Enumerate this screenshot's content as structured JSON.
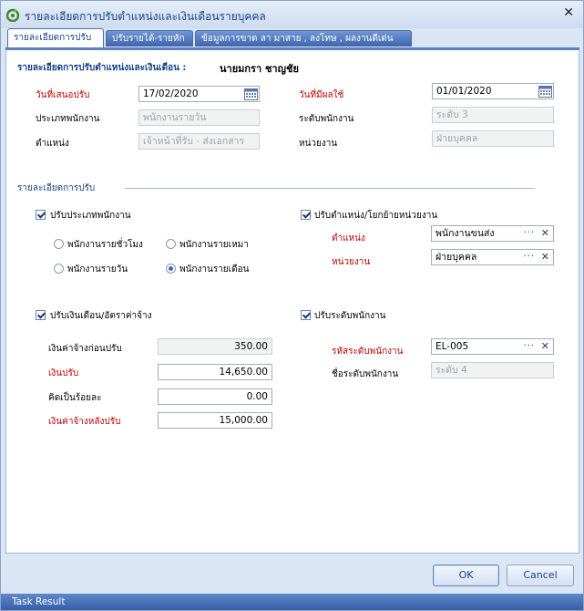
{
  "window": {
    "title": "รายละเอียดการปรับตำแหน่งและเงินเดือนรายบุคคล",
    "close_glyph": "✕"
  },
  "tabs": [
    {
      "label": "รายละเอียดการปรับ",
      "active": true
    },
    {
      "label": "ปรับรายได้-รายหัก",
      "active": false
    },
    {
      "label": "ข้อมูลการขาด ลา มาสาย , ลงโทษ , ผลงานดีเด่น",
      "active": false
    }
  ],
  "header": {
    "section_title": "รายละเอียดการปรับตำแหน่งและเงินเดือน :",
    "employee_name": "นายมกรา ชาญชัย"
  },
  "info": {
    "propose_date_label": "วันที่เสนอปรับ",
    "propose_date_value": "17/02/2020",
    "effective_date_label": "วันที่มีผลใช้",
    "effective_date_value": "01/01/2020",
    "employee_type_label": "ประเภทพนักงาน",
    "employee_type_value": "พนักงานรายวัน",
    "employee_level_label": "ระดับพนักงาน",
    "employee_level_value": "ระดับ 3",
    "position_label": "ตำแหน่ง",
    "position_value": "เจ้าหน้าที่รับ - ส่งเอกสาร",
    "department_label": "หน่วยงาน",
    "department_value": "ฝ่ายบุคคล"
  },
  "adjust": {
    "section_title": "รายละเอียดการปรับ",
    "adjust_type": {
      "label": "ปรับประเภทพนักงาน",
      "checked": true,
      "options": [
        "พนักงานรายชั่วโมง",
        "พนักงานรายเหมา",
        "พนักงานรายวัน",
        "พนักงานรายเดือน"
      ],
      "selected": "พนักงานรายเดือน"
    },
    "adjust_position": {
      "label": "ปรับตำแหน่ง/โยกย้ายหน่วยงาน",
      "checked": true,
      "position_label": "ตำแหน่ง",
      "position_value": "พนักงานขนส่ง",
      "department_label": "หน่วยงาน",
      "department_value": "ฝ่ายบุคคล",
      "ellipsis": "···",
      "clear": "✕"
    },
    "adjust_salary": {
      "label": "ปรับเงินเดือน/อัตราค่าจ้าง",
      "checked": true,
      "before_label": "เงินค่าจ้างก่อนปรับ",
      "before_value": "350.00",
      "adjust_label": "เงินปรับ",
      "adjust_value": "14,650.00",
      "percent_label": "คิดเป็นร้อยละ",
      "percent_value": "0.00",
      "after_label": "เงินค่าจ้างหลังปรับ",
      "after_value": "15,000.00"
    },
    "adjust_level": {
      "label": "ปรับระดับพนักงาน",
      "checked": true,
      "code_label": "รหัสระดับพนักงาน",
      "code_value": "EL-005",
      "name_label": "ชื่อระดับพนักงาน",
      "name_value": "ระดับ 4",
      "ellipsis": "···",
      "clear": "✕"
    }
  },
  "buttons": {
    "ok": "OK",
    "cancel": "Cancel"
  },
  "taskbar": {
    "label": "Task Result"
  },
  "colors": {
    "required_label": "#c00000",
    "section_title": "#15428b",
    "tab_active_bg": "#ffffff",
    "tab_inactive_bg": "#4f76bd"
  }
}
